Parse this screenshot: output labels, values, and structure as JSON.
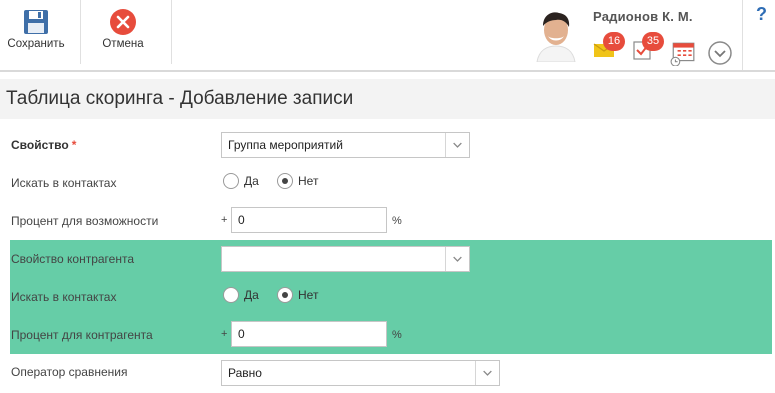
{
  "toolbar": {
    "save_label": "Сохранить",
    "cancel_label": "Отмена",
    "user_name": "Радионов К. М.",
    "mail_count": "16",
    "tasks_count": "35",
    "help_label": "?"
  },
  "page": {
    "title": "Таблица скоринга - Добавление записи"
  },
  "form": {
    "property": {
      "label": "Свойство",
      "required": "*",
      "value": "Группа мероприятий"
    },
    "search_contacts_1": {
      "label": "Искать в контактах",
      "options": [
        "Да",
        "Нет"
      ],
      "selected": "Нет"
    },
    "percent_opportunity": {
      "label": "Процент для возможности",
      "prefix": "+",
      "value": "0",
      "unit": "%"
    },
    "counterparty_property": {
      "label": "Свойство контрагента",
      "value": ""
    },
    "search_contacts_2": {
      "label": "Искать в контактах",
      "options": [
        "Да",
        "Нет"
      ],
      "selected": "Нет"
    },
    "percent_counterparty": {
      "label": "Процент для контрагента",
      "prefix": "+",
      "value": "0",
      "unit": "%"
    },
    "comparison_operator": {
      "label": "Оператор сравнения",
      "value": "Равно"
    }
  },
  "colors": {
    "highlight": "#66cda7",
    "badge": "#e74c3c",
    "cancel": "#e74c3c",
    "save": "#3f6fa8"
  }
}
